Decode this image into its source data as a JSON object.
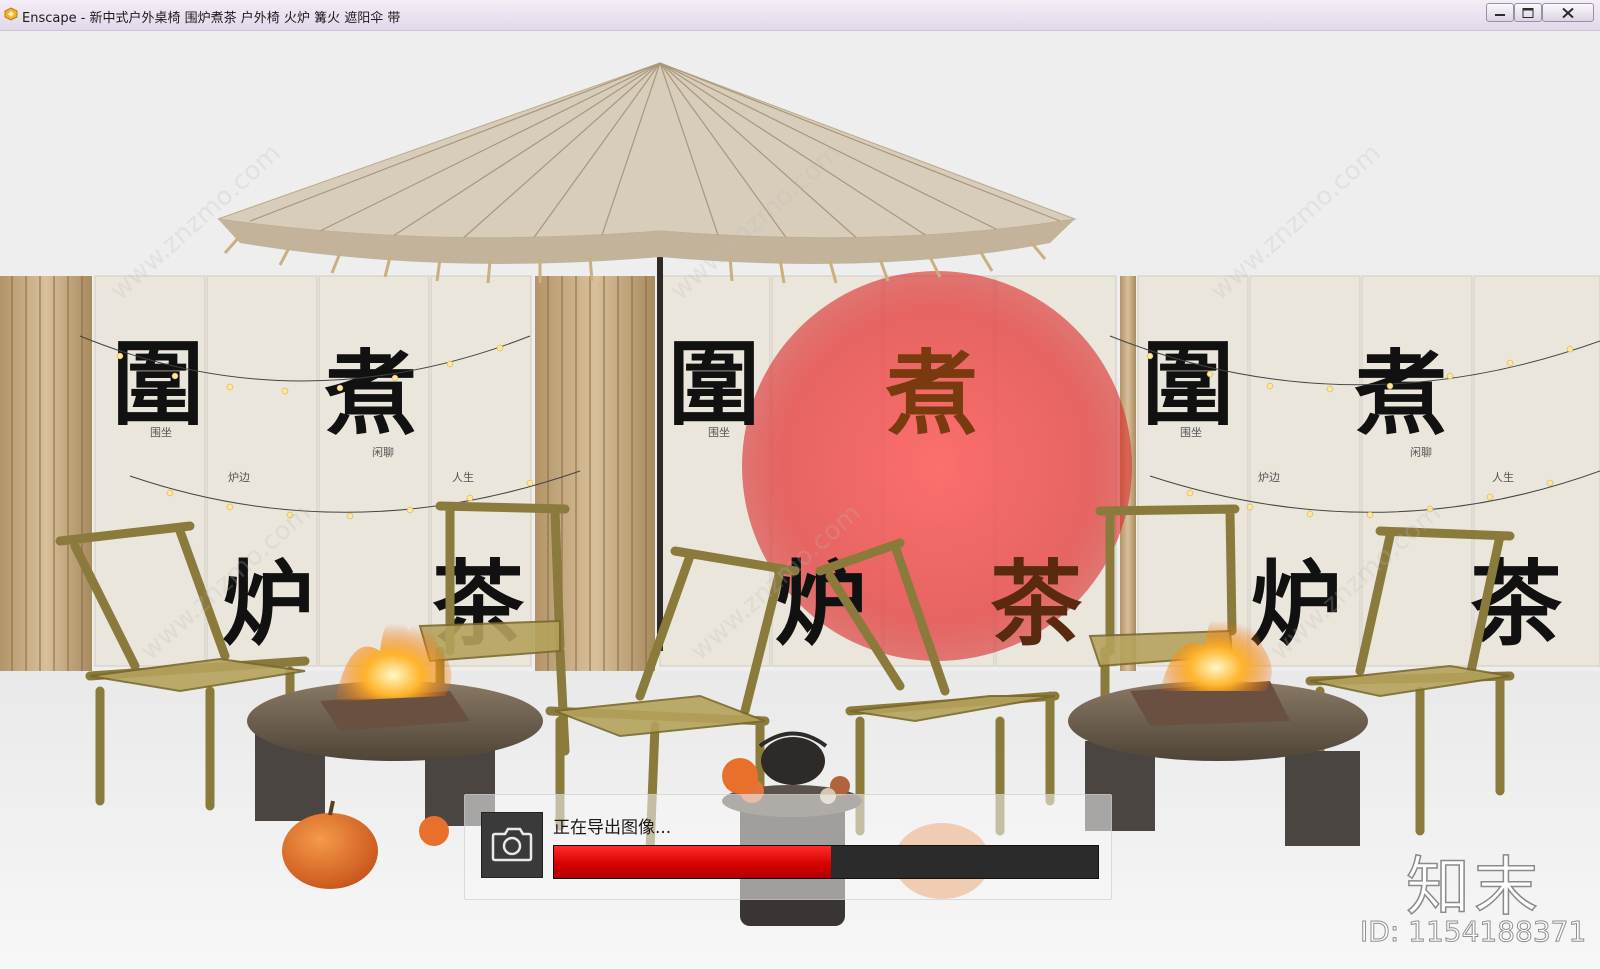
{
  "window": {
    "title": "Enscape - 新中式户外桌椅 围炉煮茶 户外椅 火炉 篝火 遮阳伞 带",
    "app_icon": "enscape-logo-icon",
    "controls": [
      "minimize-icon",
      "maximize-icon",
      "close-icon"
    ]
  },
  "scene": {
    "banner_large_chars": [
      "圍",
      "煮",
      "炉",
      "茶"
    ],
    "banner_small_text": [
      "围坐",
      "闲聊",
      "炉边",
      "人生"
    ],
    "red_sun_color": "#e23b3b"
  },
  "export": {
    "label": "正在导出图像...",
    "progress": 0.51,
    "fill_color": "#e00000",
    "icon": "camera-icon"
  },
  "watermark": {
    "logo": "知末",
    "id_text": "ID: 1154188371"
  },
  "colors": {
    "titlebar": "#ece3f0",
    "background": "#f3f3f3",
    "progress_red": "#e00000"
  }
}
